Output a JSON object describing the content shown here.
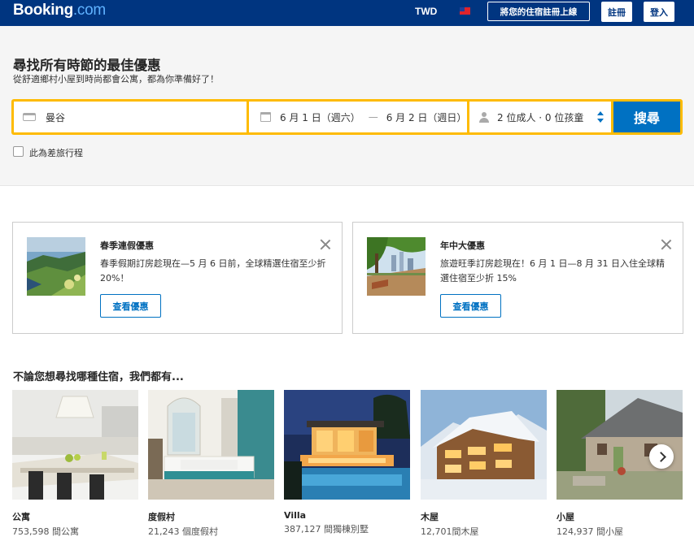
{
  "header": {
    "logo_main": "Booking",
    "logo_suffix": ".com",
    "currency": "TWD",
    "list_property": "將您的住宿註冊上線",
    "register": "註冊",
    "login": "登入"
  },
  "search": {
    "title": "尋找所有時節的最佳優惠",
    "subtitle": "從舒適鄉村小屋到時尚都會公寓，都為你準備好了！",
    "destination": "曼谷",
    "checkin": "6 月 1 日（週六）",
    "separator": "—",
    "checkout": "6 月 2 日（週日）",
    "guests": "2 位成人 · 0 位孩童",
    "search_button": "搜尋",
    "business_trip": "此為差旅行程"
  },
  "deals": [
    {
      "title": "春季連假優惠",
      "body": "春季假期訂房趁現在—5 月 6 日前，全球精選住宿至少折 20%！",
      "cta": "查看優惠"
    },
    {
      "title": "年中大優惠",
      "body": "旅遊旺季訂房趁現在！6 月 1 日—8 月 31 日入住全球精選住宿至少折 15%",
      "cta": "查看優惠"
    }
  ],
  "property_types": {
    "heading": "不論您想尋找哪種住宿，我們都有...",
    "items": [
      {
        "name": "公寓",
        "count": "753,598 間公寓"
      },
      {
        "name": "度假村",
        "count": "21,243 個度假村"
      },
      {
        "name": "Villa",
        "count": "387,127 間獨棟別墅"
      },
      {
        "name": "木屋",
        "count": "12,701間木屋"
      },
      {
        "name": "小屋",
        "count": "124,937 間小屋"
      }
    ]
  },
  "colors": {
    "brand_blue": "#003580",
    "accent_blue": "#0071c2",
    "search_yellow": "#febb02"
  },
  "icons": [
    "bed-icon",
    "calendar-icon",
    "person-icon",
    "sort-icon",
    "close-icon",
    "chevron-right-icon"
  ]
}
